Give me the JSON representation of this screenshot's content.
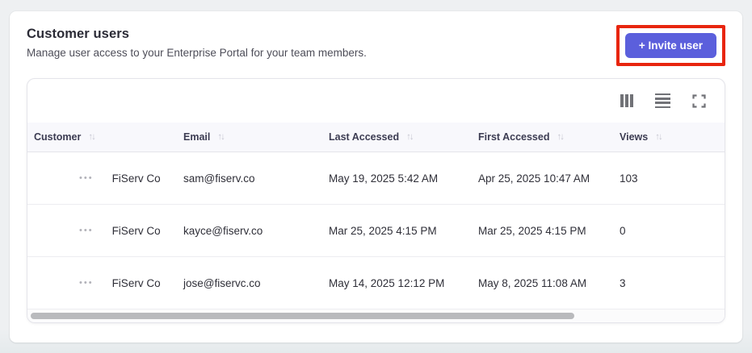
{
  "page": {
    "title": "Customer users",
    "subtitle": "Manage user access to your Enterprise Portal for your team members."
  },
  "header": {
    "invite_button_label": "+ Invite user"
  },
  "colors": {
    "accent": "#5b5fdc",
    "annotation": "#e8250e",
    "header_row_bg": "#f8f8fc"
  },
  "toolbar": {
    "icons": [
      "columns-icon",
      "density-icon",
      "fullscreen-icon"
    ]
  },
  "table": {
    "sort_icon": "↑↓",
    "row_menu_icon": "•••",
    "columns": [
      "Customer",
      "Email",
      "Last Accessed",
      "First Accessed",
      "Views"
    ],
    "rows": [
      {
        "customer": "FiServ Co",
        "email": "sam@fiserv.co",
        "last_accessed": "May 19, 2025 5:42 AM",
        "first_accessed": "Apr 25, 2025 10:47 AM",
        "views": "103"
      },
      {
        "customer": "FiServ Co",
        "email": "kayce@fiserv.co",
        "last_accessed": "Mar 25, 2025 4:15 PM",
        "first_accessed": "Mar 25, 2025 4:15 PM",
        "views": "0"
      },
      {
        "customer": "FiServ Co",
        "email": "jose@fiservc.co",
        "last_accessed": "May 14, 2025 12:12 PM",
        "first_accessed": "May 8, 2025 11:08 AM",
        "views": "3"
      }
    ]
  }
}
